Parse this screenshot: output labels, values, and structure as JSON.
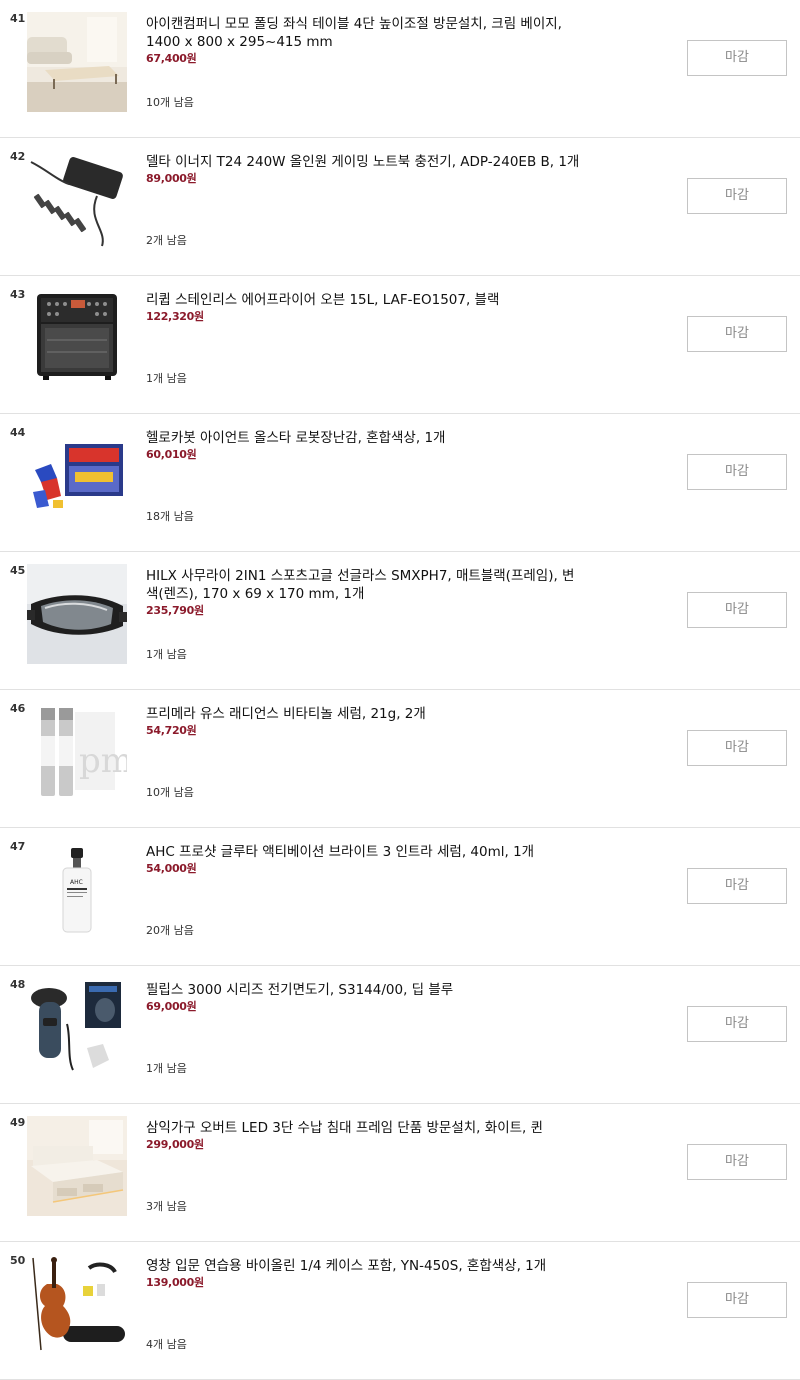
{
  "items": [
    {
      "rank": "41",
      "title": "아이캔컴퍼니 모모 폴딩 좌식 테이블 4단 높이조절 방문설치, 크림 베이지, 1400 x 800 x 295~415 mm",
      "price": "67,400원",
      "remaining": "10개 남음",
      "button": "마감",
      "image": "folding-table-image"
    },
    {
      "rank": "42",
      "title": "델타 이너지 T24 240W 올인원 게이밍 노트북 충전기, ADP-240EB B, 1개",
      "price": "89,000원",
      "remaining": "2개 남음",
      "button": "마감",
      "image": "laptop-charger-image"
    },
    {
      "rank": "43",
      "title": "리큅 스테인리스 에어프라이어 오븐 15L, LAF-EO1507, 블랙",
      "price": "122,320원",
      "remaining": "1개 남음",
      "button": "마감",
      "image": "air-fryer-oven-image"
    },
    {
      "rank": "44",
      "title": "헬로카봇 아이언트 올스타 로봇장난감, 혼합색상, 1개",
      "price": "60,010원",
      "remaining": "18개 남음",
      "button": "마감",
      "image": "robot-toy-image"
    },
    {
      "rank": "45",
      "title": "HILX 사무라이 2IN1 스포츠고글 선글라스 SMXPH7, 매트블랙(프레임), 변색(렌즈), 170 x 69 x 170 mm, 1개",
      "price": "235,790원",
      "remaining": "1개 남음",
      "button": "마감",
      "image": "sports-goggles-image"
    },
    {
      "rank": "46",
      "title": "프리메라 유스 래디언스 비타티놀 세럼, 21g, 2개",
      "price": "54,720원",
      "remaining": "10개 남음",
      "button": "마감",
      "image": "serum-bottles-image"
    },
    {
      "rank": "47",
      "title": "AHC 프로샷 글루타 액티베이션 브라이트 3 인트라 세럼, 40ml, 1개",
      "price": "54,000원",
      "remaining": "20개 남음",
      "button": "마감",
      "image": "ahc-serum-image"
    },
    {
      "rank": "48",
      "title": "필립스 3000 시리즈 전기면도기, S3144/00, 딥 블루",
      "price": "69,000원",
      "remaining": "1개 남음",
      "button": "마감",
      "image": "electric-shaver-image"
    },
    {
      "rank": "49",
      "title": "삼익가구 오버트 LED 3단 수납 침대 프레임 단품 방문설치, 화이트, 퀸",
      "price": "299,000원",
      "remaining": "3개 남음",
      "button": "마감",
      "image": "bed-frame-image"
    },
    {
      "rank": "50",
      "title": "영창 입문 연습용 바이올린 1/4 케이스 포함, YN-450S, 혼합색상, 1개",
      "price": "139,000원",
      "remaining": "4개 남음",
      "button": "마감",
      "image": "violin-set-image"
    }
  ]
}
